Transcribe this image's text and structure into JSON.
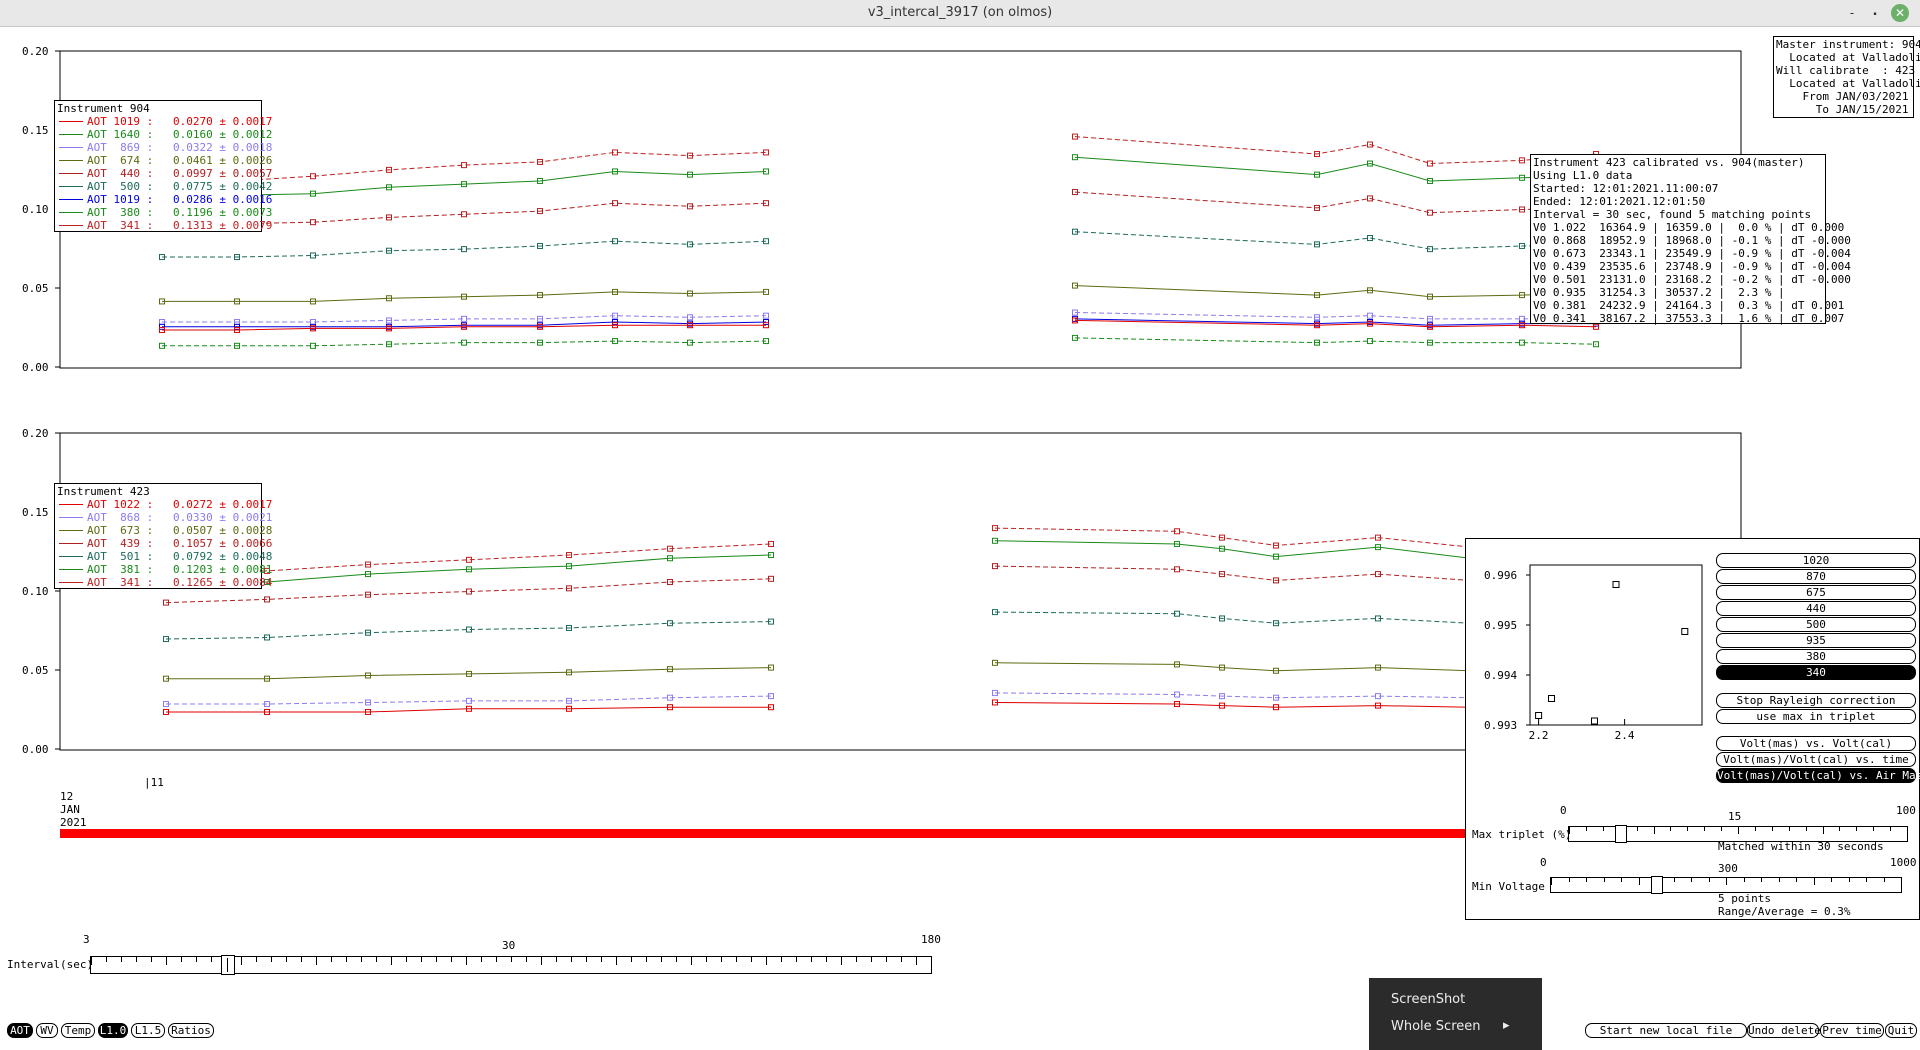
{
  "window": {
    "title": "v3_intercal_3917 (on olmos)",
    "min_glyph": "-",
    "max_glyph": "⬝",
    "close_glyph": "✕"
  },
  "y_ticks": [
    "0.20",
    "0.15",
    "0.10",
    "0.05",
    "0.00"
  ],
  "master_info": [
    "Master instrument: 904",
    "  Located at Valladolid",
    "Will calibrate  : 423",
    "  Located at Valladolid",
    "    From JAN/03/2021",
    "      To JAN/15/2021"
  ],
  "legend904": {
    "title": "Instrument 904",
    "items": [
      {
        "label": "AOT 1019 :",
        "value": "0.0270 ± 0.0017",
        "color": "#e00000"
      },
      {
        "label": "AOT 1640 :",
        "value": "0.0160 ± 0.0012",
        "color": "#1a8a1a"
      },
      {
        "label": "AOT  869 :",
        "value": "0.0322 ± 0.0018",
        "color": "#8a7cf0"
      },
      {
        "label": "AOT  674 :",
        "value": "0.0461 ± 0.0026",
        "color": "#5e6a10"
      },
      {
        "label": "AOT  440 :",
        "value": "0.0997 ± 0.0057",
        "color": "#b02020"
      },
      {
        "label": "AOT  500 :",
        "value": "0.0775 ± 0.0042",
        "color": "#1d6a5a"
      },
      {
        "label": "AOT 1019 :",
        "value": "0.0286 ± 0.0016",
        "color": "#0000e0"
      },
      {
        "label": "AOT  380 :",
        "value": "0.1196 ± 0.0073",
        "color": "#1a8a1a"
      },
      {
        "label": "AOT  341 :",
        "value": "0.1313 ± 0.0079",
        "color": "#c02020"
      }
    ]
  },
  "legend423": {
    "title": "Instrument 423",
    "items": [
      {
        "label": "AOT 1022 :",
        "value": "0.0272 ± 0.0017",
        "color": "#e00000"
      },
      {
        "label": "AOT  868 :",
        "value": "0.0330 ± 0.0021",
        "color": "#8a7cf0"
      },
      {
        "label": "AOT  673 :",
        "value": "0.0507 ± 0.0028",
        "color": "#5e6a10"
      },
      {
        "label": "AOT  439 :",
        "value": "0.1057 ± 0.0066",
        "color": "#b02020"
      },
      {
        "label": "AOT  501 :",
        "value": "0.0792 ± 0.0048",
        "color": "#1d6a5a"
      },
      {
        "label": "AOT  381 :",
        "value": "0.1203 ± 0.0081",
        "color": "#1a8a1a"
      },
      {
        "label": "AOT  341 :",
        "value": "0.1265 ± 0.0084",
        "color": "#c02020"
      }
    ]
  },
  "calib_info": [
    "Instrument 423 calibrated vs. 904(master)",
    "Using L1.0 data",
    "Started: 12:01:2021.11:00:07",
    "Ended: 12:01:2021.12:01:50",
    "Interval = 30 sec, found 5 matching points",
    "V0 1.022  16364.9 | 16359.0 |  0.0 % | dT 0.000",
    "V0 0.868  18952.9 | 18968.0 | -0.1 % | dT -0.000",
    "V0 0.673  23343.1 | 23549.9 | -0.9 % | dT -0.004",
    "V0 0.439  23535.6 | 23748.9 | -0.9 % | dT -0.004",
    "V0 0.501  23131.0 | 23168.2 | -0.2 % | dT -0.000",
    "V0 0.935  31254.3 | 30537.2 |  2.3 % |",
    "V0 0.381  24232.9 | 24164.3 |  0.3 % | dT 0.001",
    "V0 0.341  38167.2 | 37553.3 |  1.6 % | dT 0.007"
  ],
  "time_axis": {
    "hour": "11",
    "day": "12",
    "month": "JAN",
    "year": "2021"
  },
  "interval_slider": {
    "label": "Interval(sec)",
    "min": "3",
    "mid": "30",
    "max": "180",
    "value": 30
  },
  "ratio_panel": {
    "y_ticks": [
      "0.996",
      "0.995",
      "0.994",
      "0.993"
    ],
    "x_ticks": [
      "2.2",
      "2.4"
    ],
    "wavelengths": [
      "1020",
      "870",
      "675",
      "440",
      "500",
      "935",
      "380",
      "340"
    ],
    "selected_wavelength": "340",
    "stop_rayleigh": "Stop Rayleigh correction",
    "use_max": "use max in triplet",
    "plot_modes": [
      "Volt(mas) vs. Volt(cal)",
      "Volt(mas)/Volt(cal) vs. time",
      "Volt(mas)/Volt(cal) vs. Air Mass"
    ],
    "selected_mode": "Volt(mas)/Volt(cal) vs. Air Mass",
    "max_triplet": {
      "label": "Max triplet (%)",
      "min": "0",
      "mid": "15",
      "max": "100",
      "value": 15
    },
    "min_voltage": {
      "label": "Min Voltage",
      "min": "0",
      "mid": "300",
      "max": "1000",
      "value": 300
    },
    "matched_text": "Matched within 30 seconds",
    "points_text": "5 points",
    "range_text": "Range/Average = 0.3%"
  },
  "bottom_left_buttons": [
    "AOT",
    "WV",
    "Temp",
    "L1.0",
    "L1.5",
    "Ratios"
  ],
  "bottom_left_selected": [
    "AOT",
    "L1.0"
  ],
  "bottom_right_buttons": [
    "Start new local file",
    "Undo delete",
    "Prev time",
    "Quit"
  ],
  "context_menu": {
    "item1": "ScreenShot",
    "item2": "Whole Screen",
    "arrow": "▸"
  }
}
